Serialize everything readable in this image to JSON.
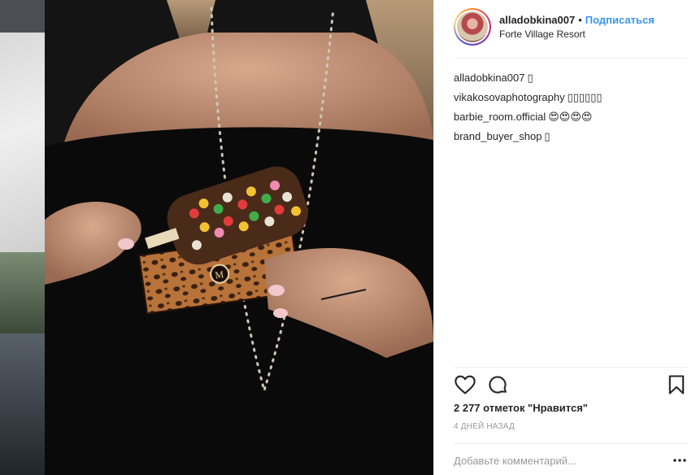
{
  "post": {
    "username": "alladobkina007",
    "separator": "•",
    "follow_label": "Подписаться",
    "location": "Forte Village Resort"
  },
  "comments": [
    {
      "user": "alladobkina007",
      "text": "▯"
    },
    {
      "user": "vikakosovaphotography",
      "text": "▯▯▯▯▯▯"
    },
    {
      "user": "barbie_room.official",
      "text": "😍😍😍😍"
    },
    {
      "user": "brand_buyer_shop",
      "text": "▯"
    }
  ],
  "actions": {
    "like_icon": "heart-icon",
    "comment_icon": "comment-icon",
    "save_icon": "bookmark-icon"
  },
  "likes_text": "2 277 отметок \"Нравится\"",
  "time_text": "4 ДНЕЙ НАЗАД",
  "add_comment": {
    "placeholder": "Добавьте комментарий..."
  },
  "more_icon": "ellipsis-icon",
  "colors": {
    "follow": "#3897f0",
    "muted": "#999999",
    "divider": "#efefef",
    "text": "#262626"
  }
}
